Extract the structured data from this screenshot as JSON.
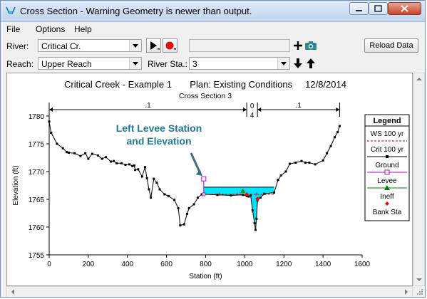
{
  "window": {
    "title": "Cross Section - Warning Geometry is newer than output."
  },
  "menu": [
    {
      "label": "File"
    },
    {
      "label": "Options"
    },
    {
      "label": "Help"
    }
  ],
  "toolbar": {
    "river_label": "River:",
    "river_value": "Critical Cr.",
    "reach_label": "Reach:",
    "reach_value": "Upper Reach",
    "river_sta_label": "River Sta.:",
    "river_sta_value": "3",
    "reload_label": "Reload Data"
  },
  "plot": {
    "title": "Critical Creek - Example 1       Plan: Existing Conditions     12/8/2014",
    "subtitle": "Cross Section 3",
    "annotation": "Left Levee Station\nand Elevation",
    "annotation_color": "#1e7a99",
    "mannings_labels": [
      ".1",
      "0",
      "4",
      ".1"
    ],
    "legend_title": "Legend"
  },
  "chart_data": {
    "type": "line",
    "title": "Critical Creek - Example 1       Plan: Existing Conditions     12/8/2014",
    "subtitle": "Cross Section 3",
    "xlabel": "Station (ft)",
    "ylabel": "Elevation (ft)",
    "xlim": [
      0,
      1600
    ],
    "ylim": [
      1755,
      1780
    ],
    "xticks": [
      0,
      200,
      400,
      600,
      800,
      1000,
      1200,
      1400,
      1600
    ],
    "yticks": [
      1755,
      1760,
      1765,
      1770,
      1775,
      1780
    ],
    "legend_position": "right",
    "series": [
      {
        "name": "WS 100 yr",
        "color": "#cc0000",
        "values": [
          [
            790,
            1767.2
          ],
          [
            1150,
            1767.2
          ]
        ]
      },
      {
        "name": "Crit 100 yr",
        "color": "#cc0000",
        "values": [
          [
            790,
            1765.9
          ],
          [
            1150,
            1765.9
          ]
        ]
      },
      {
        "name": "Ground",
        "color": "#000000",
        "values": [
          [
            0,
            1779
          ],
          [
            10,
            1777
          ],
          [
            40,
            1775
          ],
          [
            70,
            1774.2
          ],
          [
            90,
            1773.5
          ],
          [
            100,
            1773.4
          ],
          [
            130,
            1773.3
          ],
          [
            160,
            1772.8
          ],
          [
            185,
            1773.3
          ],
          [
            200,
            1772.3
          ],
          [
            220,
            1773.2
          ],
          [
            250,
            1772.9
          ],
          [
            270,
            1772.3
          ],
          [
            290,
            1772.6
          ],
          [
            315,
            1771.8
          ],
          [
            330,
            1771.9
          ],
          [
            345,
            1771.5
          ],
          [
            370,
            1771.5
          ],
          [
            390,
            1771.2
          ],
          [
            410,
            1771.3
          ],
          [
            425,
            1771.0
          ],
          [
            435,
            1771.1
          ],
          [
            440,
            1770.3
          ],
          [
            455,
            1770.4
          ],
          [
            475,
            1769.1
          ],
          [
            490,
            1770.8
          ],
          [
            500,
            1768.8
          ],
          [
            510,
            1766.8
          ],
          [
            520,
            1765.3
          ],
          [
            535,
            1768.7
          ],
          [
            550,
            1768.0
          ],
          [
            565,
            1766.8
          ],
          [
            590,
            1765.9
          ],
          [
            610,
            1765.6
          ],
          [
            640,
            1764.9
          ],
          [
            660,
            1763.4
          ],
          [
            670,
            1760.3
          ],
          [
            690,
            1760.5
          ],
          [
            705,
            1762.4
          ],
          [
            715,
            1763.4
          ],
          [
            740,
            1764.1
          ],
          [
            760,
            1765.3
          ],
          [
            780,
            1765.9
          ],
          [
            790,
            1765.9
          ],
          [
            860,
            1765.8
          ],
          [
            930,
            1765.7
          ],
          [
            990,
            1765.8
          ],
          [
            1010,
            1765.6
          ],
          [
            1020,
            1765.5
          ],
          [
            1030,
            1765.7
          ],
          [
            1040,
            1763.0
          ],
          [
            1050,
            1760.7
          ],
          [
            1055,
            1759.5
          ],
          [
            1060,
            1761.5
          ],
          [
            1065,
            1764.8
          ],
          [
            1080,
            1765.3
          ],
          [
            1100,
            1766.0
          ],
          [
            1150,
            1766.2
          ],
          [
            1170,
            1768.5
          ],
          [
            1185,
            1769.3
          ],
          [
            1210,
            1770.0
          ],
          [
            1230,
            1771.4
          ],
          [
            1260,
            1771.6
          ],
          [
            1290,
            1771.9
          ],
          [
            1310,
            1771.6
          ],
          [
            1330,
            1771.6
          ],
          [
            1360,
            1771.3
          ],
          [
            1400,
            1772.0
          ],
          [
            1420,
            1773.3
          ],
          [
            1440,
            1774.6
          ],
          [
            1460,
            1776.2
          ],
          [
            1475,
            1777.1
          ],
          [
            1485,
            1778.2
          ]
        ]
      },
      {
        "name": "Levee",
        "color": "#cc00cc",
        "values": [
          [
            790,
            1768.7
          ],
          [
            790,
            1765.9
          ]
        ]
      },
      {
        "name": "Ineff",
        "color": "#008000",
        "values": [
          [
            990,
            1766.5
          ]
        ]
      },
      {
        "name": "Bank Sta",
        "color": "#ff0000",
        "values": [
          [
            1010,
            1765.9
          ],
          [
            1065,
            1765.1
          ]
        ]
      }
    ],
    "water_fill": {
      "color": "#00e5ff",
      "ws_elevation": 1767.2
    }
  }
}
